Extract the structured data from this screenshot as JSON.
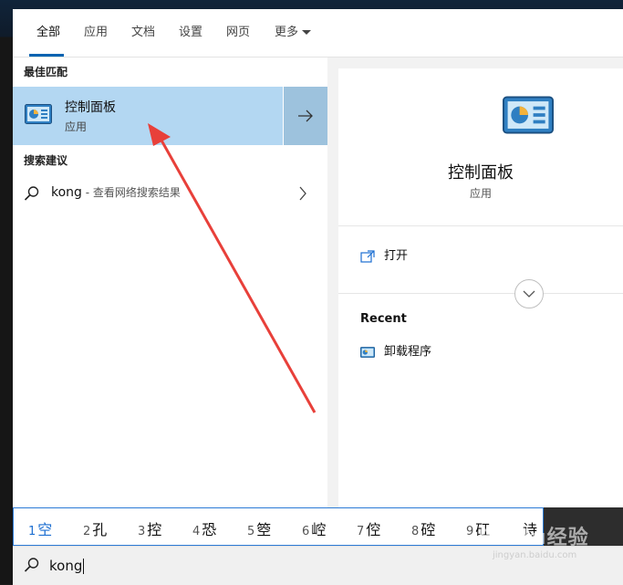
{
  "tabs": [
    {
      "label": "全部",
      "active": true
    },
    {
      "label": "应用"
    },
    {
      "label": "文档"
    },
    {
      "label": "设置"
    },
    {
      "label": "网页"
    },
    {
      "label": "更多"
    }
  ],
  "left": {
    "best_match_header": "最佳匹配",
    "best_match": {
      "title": "控制面板",
      "subtitle": "应用"
    },
    "suggestions_header": "搜索建议",
    "suggestion": {
      "query": "kong",
      "description": " - 查看网络搜索结果"
    }
  },
  "right": {
    "title": "控制面板",
    "subtitle": "应用",
    "open_label": "打开",
    "recent_header": "Recent",
    "recent_item": "卸载程序"
  },
  "ime": {
    "candidates": [
      {
        "num": "1",
        "char": "空"
      },
      {
        "num": "2",
        "char": "孔"
      },
      {
        "num": "3",
        "char": "控"
      },
      {
        "num": "4",
        "char": "恐"
      },
      {
        "num": "5",
        "char": "箜"
      },
      {
        "num": "6",
        "char": "崆"
      },
      {
        "num": "7",
        "char": "倥"
      },
      {
        "num": "8",
        "char": "硿"
      },
      {
        "num": "9",
        "char": "矼"
      },
      {
        "num": "",
        "char": "诗"
      }
    ]
  },
  "search": {
    "query": "kong"
  },
  "watermark": {
    "text": "Baidu经验",
    "sub": "jingyan.baidu.com"
  },
  "colors": {
    "accent": "#0063b1",
    "selected_bg": "#b3d7f2",
    "annotation_arrow": "#e8403a"
  }
}
